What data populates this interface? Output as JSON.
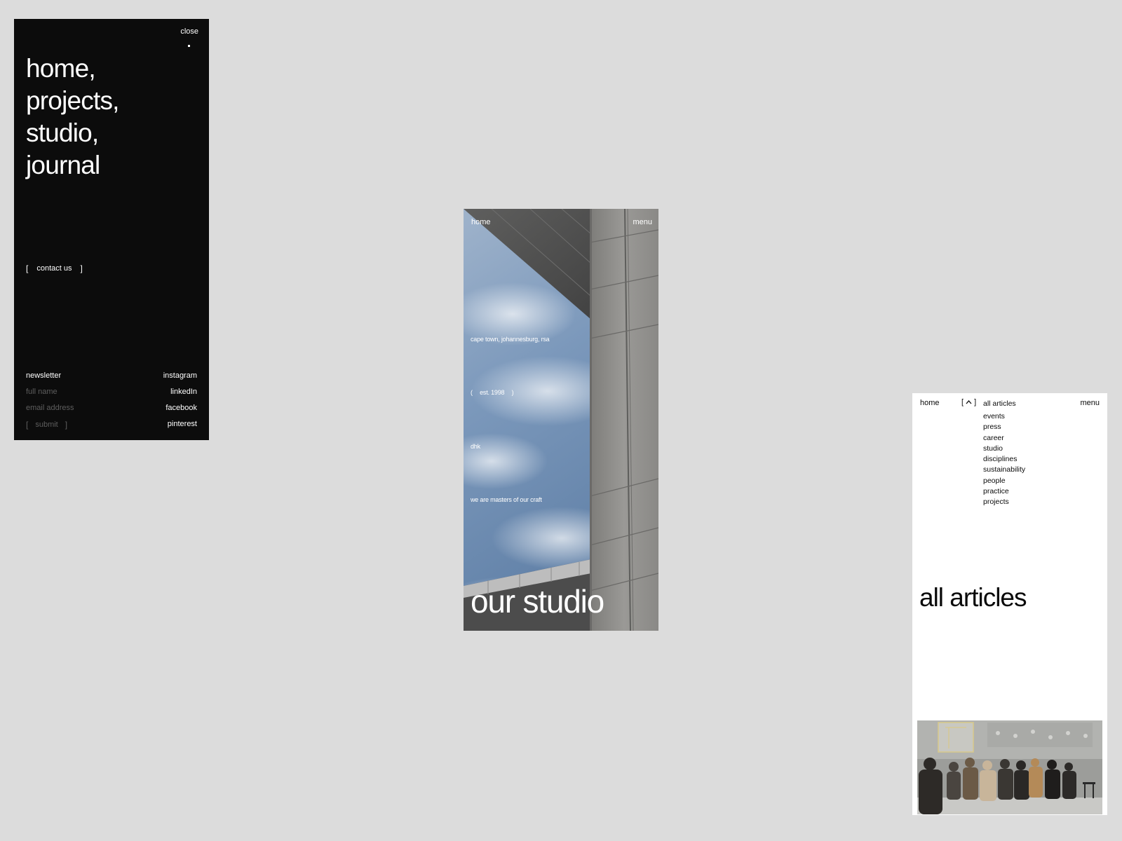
{
  "menu_overlay": {
    "close_label": "close",
    "nav_items": [
      "home,",
      "projects,",
      "studio,",
      "journal"
    ],
    "contact": {
      "open": "[",
      "label": "contact us",
      "close": "]"
    },
    "newsletter": {
      "title": "newsletter",
      "name_placeholder": "full name",
      "email_placeholder": "email address",
      "submit": {
        "open": "[",
        "label": "submit",
        "close": "]"
      }
    },
    "social": [
      "instagram",
      "linkedIn",
      "facebook",
      "pinterest"
    ],
    "colors": {
      "background": "#0c0c0c",
      "text": "#ffffff",
      "muted": "#5e5e5e"
    }
  },
  "studio_page": {
    "nav_home": "home",
    "nav_menu": "menu",
    "location": "cape town, johannesburg, rsa",
    "established": {
      "open": "(",
      "label": "est. 1998",
      "close": ")"
    },
    "name": "dhk",
    "tagline": "we are masters of our craft",
    "headline": "our studio",
    "colors": {
      "sky": "#6f8fb3",
      "concrete": "#8d8c89",
      "text": "#ffffff"
    }
  },
  "journal_page": {
    "nav_home": "home",
    "nav_menu": "menu",
    "filter_toggle": {
      "open": "[",
      "icon": "chevron-up-icon",
      "close": "]"
    },
    "filters": [
      "all articles",
      "events",
      "press",
      "career",
      "studio",
      "disciplines",
      "sustainability",
      "people",
      "practice",
      "projects"
    ],
    "active_filter": "all articles",
    "heading": "all articles",
    "colors": {
      "background": "#ffffff",
      "text": "#0a0a0a"
    }
  },
  "canvas": {
    "background": "#dcdcdc"
  }
}
